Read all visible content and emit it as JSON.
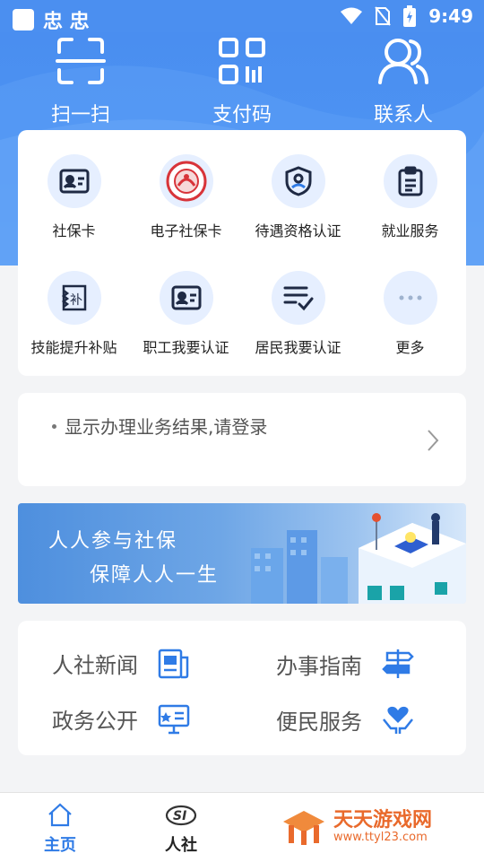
{
  "status_bar": {
    "app_glyphs": "忠 忠",
    "time": "9:49"
  },
  "quick_actions": [
    {
      "label": "扫一扫",
      "icon": "scan-icon"
    },
    {
      "label": "支付码",
      "icon": "qr-code-icon"
    },
    {
      "label": "联系人",
      "icon": "contacts-icon"
    }
  ],
  "services": [
    {
      "label": "社保卡",
      "icon": "id-card-icon"
    },
    {
      "label": "电子社保卡",
      "icon": "e-social-card-icon"
    },
    {
      "label": "待遇资格认证",
      "icon": "shield-user-icon"
    },
    {
      "label": "就业服务",
      "icon": "clipboard-icon"
    },
    {
      "label": "技能提升补贴",
      "icon": "subsidy-icon"
    },
    {
      "label": "职工我要认证",
      "icon": "id-card-icon"
    },
    {
      "label": "居民我要认证",
      "icon": "checklist-icon"
    },
    {
      "label": "更多",
      "icon": "more-icon"
    }
  ],
  "login_prompt": "显示办理业务结果,请登录",
  "banner": {
    "line1": "人人参与社保",
    "line2": "保障人人一生"
  },
  "links": [
    {
      "label": "人社新闻",
      "icon": "news-icon"
    },
    {
      "label": "办事指南",
      "icon": "signpost-icon"
    },
    {
      "label": "政务公开",
      "icon": "monitor-icon"
    },
    {
      "label": "便民服务",
      "icon": "heart-hands-icon"
    }
  ],
  "bottom_nav": [
    {
      "label": "主页",
      "icon": "home-icon"
    },
    {
      "label": "人社",
      "icon": "si-logo-icon"
    }
  ],
  "watermark": {
    "title": "天天游戏网",
    "url": "www.ttyl23.com"
  },
  "colors": {
    "primary": "#4b8ff0",
    "accent": "#2f7be6",
    "icon_dark": "#1f2a44",
    "watermark": "#e96a2c"
  }
}
